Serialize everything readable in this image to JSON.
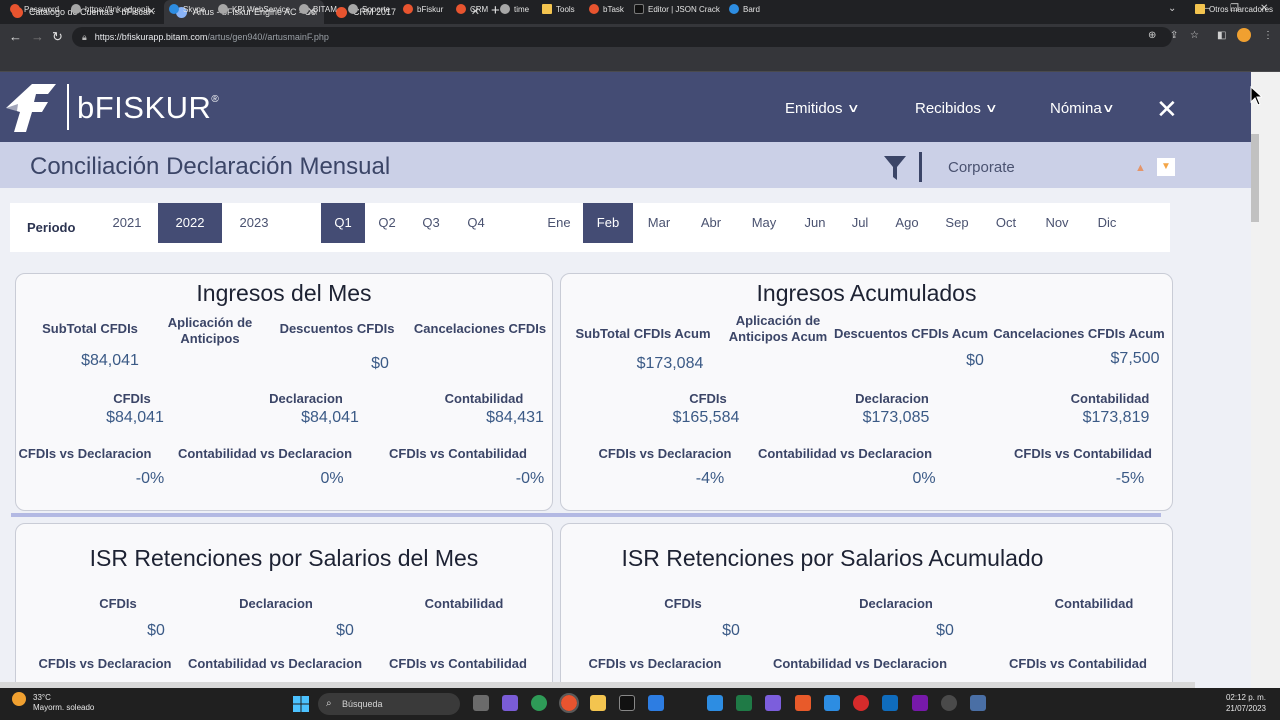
{
  "browser": {
    "tabs": [
      {
        "title": "Catalogo de Cuentas - bFiscal"
      },
      {
        "title": "Artus - bFiskur Engine AC - Conc"
      },
      {
        "title": "CRM 2017"
      }
    ],
    "url_host": "https://bfiskurapp.bitam.com",
    "url_path": "/artus/gen940//artusmainF.php",
    "bookmarks": [
      "Password",
      "https://link.edgepil...",
      "Skype",
      "KPI WebService",
      "BITAM",
      "Soporte",
      "bFiskur",
      "CRM",
      "time",
      "Tools",
      "bTask",
      "Editor | JSON Crack",
      "Bard"
    ],
    "other_bookmarks": "Otros marcadores"
  },
  "app": {
    "brand": "bFISKUR",
    "brand_mark": "®",
    "nav": [
      "Emitidos",
      "Recibidos",
      "Nómina"
    ],
    "page_title": "Conciliación Declaración Mensual",
    "company": "Corporate",
    "period_label": "Periodo",
    "years": [
      "2021",
      "2022",
      "2023"
    ],
    "quarters": [
      "Q1",
      "Q2",
      "Q3",
      "Q4"
    ],
    "months": [
      "Ene",
      "Feb",
      "Mar",
      "Abr",
      "May",
      "Jun",
      "Jul",
      "Ago",
      "Sep",
      "Oct",
      "Nov",
      "Dic"
    ]
  },
  "cards": {
    "ingresos_mes": {
      "title": "Ingresos del Mes",
      "subtotal_label": "SubTotal CFDIs",
      "subtotal": "$84,041",
      "anticipos_label": "Aplicación de Anticipos",
      "descuentos_label": "Descuentos CFDIs",
      "descuentos": "$0",
      "cancelaciones_label": "Cancelaciones CFDIs",
      "cfdis_label": "CFDIs",
      "cfdis": "$84,041",
      "declaracion_label": "Declaracion",
      "declaracion": "$84,041",
      "contabilidad_label": "Contabilidad",
      "contabilidad": "$84,431",
      "cvd_label": "CFDIs vs Declaracion",
      "cvd": "-0%",
      "covd_label": "Contabilidad vs Declaracion",
      "covd": "0%",
      "cvc_label": "CFDIs vs Contabilidad",
      "cvc": "-0%"
    },
    "ingresos_acum": {
      "title": "Ingresos Acumulados",
      "subtotal_label": "SubTotal CFDIs Acum",
      "subtotal": "$173,084",
      "anticipos_label": "Aplicación de Anticipos Acum",
      "descuentos_label": "Descuentos CFDIs Acum",
      "descuentos": "$0",
      "cancelaciones_label": "Cancelaciones CFDIs Acum",
      "cancelaciones": "$7,500",
      "cfdis_label": "CFDIs",
      "cfdis": "$165,584",
      "declaracion_label": "Declaracion",
      "declaracion": "$173,085",
      "contabilidad_label": "Contabilidad",
      "contabilidad": "$173,819",
      "cvd_label": "CFDIs vs Declaracion",
      "cvd": "-4%",
      "covd_label": "Contabilidad vs Declaracion",
      "covd": "0%",
      "cvc_label": "CFDIs vs Contabilidad",
      "cvc": "-5%"
    },
    "isr_mes": {
      "title": "ISR Retenciones por Salarios del Mes",
      "cfdis_label": "CFDIs",
      "cfdis": "$0",
      "declaracion_label": "Declaracion",
      "declaracion": "$0",
      "contabilidad_label": "Contabilidad",
      "cvd_label": "CFDIs vs Declaracion",
      "covd_label": "Contabilidad vs Declaracion",
      "cvc_label": "CFDIs vs Contabilidad"
    },
    "isr_acum": {
      "title": "ISR Retenciones por Salarios Acumulado",
      "cfdis_label": "CFDIs",
      "cfdis": "$0",
      "declaracion_label": "Declaracion",
      "declaracion": "$0",
      "contabilidad_label": "Contabilidad",
      "cvd_label": "CFDIs vs Declaracion",
      "covd_label": "Contabilidad vs Declaracion",
      "cvc_label": "CFDIs vs Contabilidad"
    }
  },
  "taskbar": {
    "temp": "33°C",
    "weather": "Mayorm. soleado",
    "search": "Búsqueda",
    "time": "02:12 p. m.",
    "date": "21/07/2023"
  }
}
